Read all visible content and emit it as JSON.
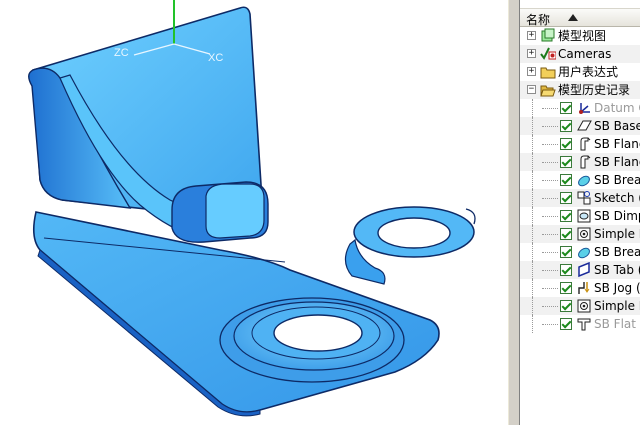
{
  "viewport": {
    "axis_labels": {
      "z": "ZC",
      "x": "XC"
    },
    "part_color": "#4fb6f4",
    "edge_color": "#0d2a66"
  },
  "navigator": {
    "column_header": "名称",
    "items": [
      {
        "label": "模型视图",
        "expander": "+",
        "icon": "model-views-icon",
        "level": 0
      },
      {
        "label": "Cameras",
        "expander": "+",
        "icon": "cameras-icon",
        "level": 0
      },
      {
        "label": "用户表达式",
        "expander": "+",
        "icon": "folder-icon",
        "level": 0
      },
      {
        "label": "模型历史记录",
        "expander": "−",
        "icon": "open-folder-icon",
        "level": 0
      },
      {
        "label": "Datum C",
        "icon": "datum-csys-icon",
        "checked": true,
        "greyed": true
      },
      {
        "label": "SB Base",
        "icon": "sheet-base-icon",
        "checked": true
      },
      {
        "label": "SB Flang",
        "icon": "flange-icon",
        "checked": true
      },
      {
        "label": "SB Flang",
        "icon": "flange-icon",
        "checked": true
      },
      {
        "label": "SB Break",
        "icon": "break-icon",
        "checked": true
      },
      {
        "label": "Sketch (",
        "icon": "sketch-icon",
        "checked": true
      },
      {
        "label": "SB Dimp",
        "icon": "dimple-icon",
        "checked": true
      },
      {
        "label": "Simple H",
        "icon": "hole-icon",
        "checked": true
      },
      {
        "label": "SB Break",
        "icon": "break-icon",
        "checked": true
      },
      {
        "label": "SB Tab (",
        "icon": "tab-icon",
        "checked": true
      },
      {
        "label": "SB Jog (",
        "icon": "jog-icon",
        "checked": true
      },
      {
        "label": "Simple H",
        "icon": "hole-icon",
        "checked": true
      },
      {
        "label": "SB Flat S",
        "icon": "flat-solid-icon",
        "checked": true,
        "greyed": true
      }
    ]
  }
}
